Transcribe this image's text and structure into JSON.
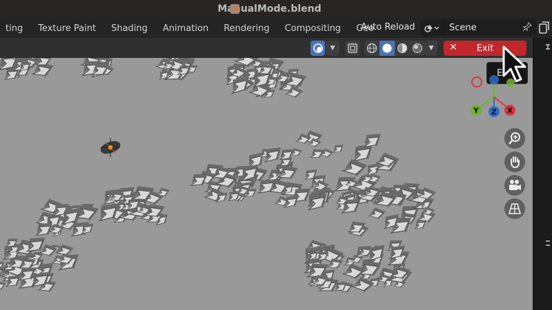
{
  "window": {
    "title": "ManualMode.blend"
  },
  "workspace_tabs": [
    {
      "label": "ting"
    },
    {
      "label": "Texture Paint"
    },
    {
      "label": "Shading"
    },
    {
      "label": "Animation"
    },
    {
      "label": "Rendering"
    },
    {
      "label": "Compositing"
    },
    {
      "label": "Geo"
    }
  ],
  "toolbar": {
    "auto_reload_label": "Auto Reload",
    "scene_name": "Scene",
    "exit_label": "Exit"
  },
  "tooltip": {
    "text": "E"
  },
  "gizmo": {
    "y_label": "Y",
    "z_label": "Z",
    "x_label": "X"
  },
  "colors": {
    "exit_button": "#c2272d",
    "active_toggle": "#4a73b8",
    "viewport_background": "#999999",
    "axis_x": "#e0323f",
    "axis_y": "#6fb52b",
    "axis_z": "#2f6ec9"
  },
  "icons": {
    "overlay": "overlay-icon",
    "xray": "xray-icon",
    "shading": [
      "wireframe-shading-icon",
      "solid-shading-icon",
      "material-shading-icon",
      "rendered-shading-icon"
    ],
    "navigation": [
      "zoom-icon",
      "hand-pan-icon",
      "camera-icon",
      "grid-perspective-icon"
    ]
  }
}
